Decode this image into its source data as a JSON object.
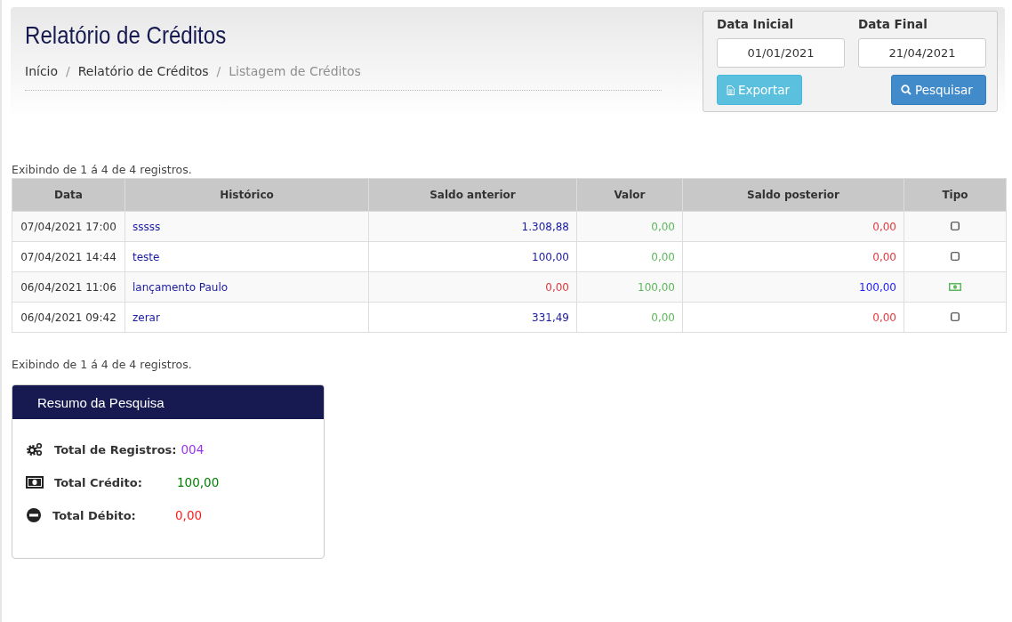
{
  "header": {
    "title": "Relatório de Créditos",
    "breadcrumb": [
      {
        "label": "Início",
        "current": false
      },
      {
        "label": "Relatório de Créditos",
        "current": false
      },
      {
        "label": "Listagem de Créditos",
        "current": true
      }
    ],
    "separator": "/"
  },
  "filter": {
    "start_label": "Data Inicial",
    "start_value": "01/01/2021",
    "end_label": "Data Final",
    "end_value": "21/04/2021",
    "export_button": "Exportar",
    "search_button": "Pesquisar"
  },
  "count_top": "Exibindo de 1 á 4 de 4 registros.",
  "table": {
    "columns": [
      "Data",
      "Histórico",
      "Saldo anterior",
      "Valor",
      "Saldo posterior",
      "Tipo"
    ],
    "rows": [
      {
        "data": "07/04/2021 17:00",
        "historico": "sssss",
        "saldo_anterior": {
          "text": "1.308,88",
          "color": "#1a1aa0"
        },
        "valor": {
          "text": "0,00",
          "color": "#5cb85c"
        },
        "saldo_posterior": {
          "text": "0,00",
          "color": "#e0393e"
        },
        "tipo": {
          "kind": "box"
        }
      },
      {
        "data": "07/04/2021 14:44",
        "historico": "teste",
        "saldo_anterior": {
          "text": "100,00",
          "color": "#1a1aa0"
        },
        "valor": {
          "text": "0,00",
          "color": "#5cb85c"
        },
        "saldo_posterior": {
          "text": "0,00",
          "color": "#e0393e"
        },
        "tipo": {
          "kind": "box"
        }
      },
      {
        "data": "06/04/2021 11:06",
        "historico": "lançamento Paulo",
        "saldo_anterior": {
          "text": "0,00",
          "color": "#e0393e"
        },
        "valor": {
          "text": "100,00",
          "color": "#5cb85c"
        },
        "saldo_posterior": {
          "text": "100,00",
          "color": "#1a1aff"
        },
        "tipo": {
          "kind": "money"
        }
      },
      {
        "data": "06/04/2021 09:42",
        "historico": "zerar",
        "saldo_anterior": {
          "text": "331,49",
          "color": "#1a1aa0"
        },
        "valor": {
          "text": "0,00",
          "color": "#5cb85c"
        },
        "saldo_posterior": {
          "text": "0,00",
          "color": "#e0393e"
        },
        "tipo": {
          "kind": "box"
        }
      }
    ]
  },
  "count_bottom": "Exibindo de 1 á 4 de 4 registros.",
  "summary": {
    "title": "Resumo da Pesquisa",
    "items": [
      {
        "kind": "gears",
        "label": "Total de Registros:",
        "value": "004",
        "color": "#9933ee"
      },
      {
        "kind": "money",
        "label": "Total Crédito:",
        "value": "100,00",
        "color": "#008000"
      },
      {
        "kind": "minus",
        "label": "Total Débito:",
        "value": "0,00",
        "color": "#ff1a1a"
      }
    ]
  }
}
